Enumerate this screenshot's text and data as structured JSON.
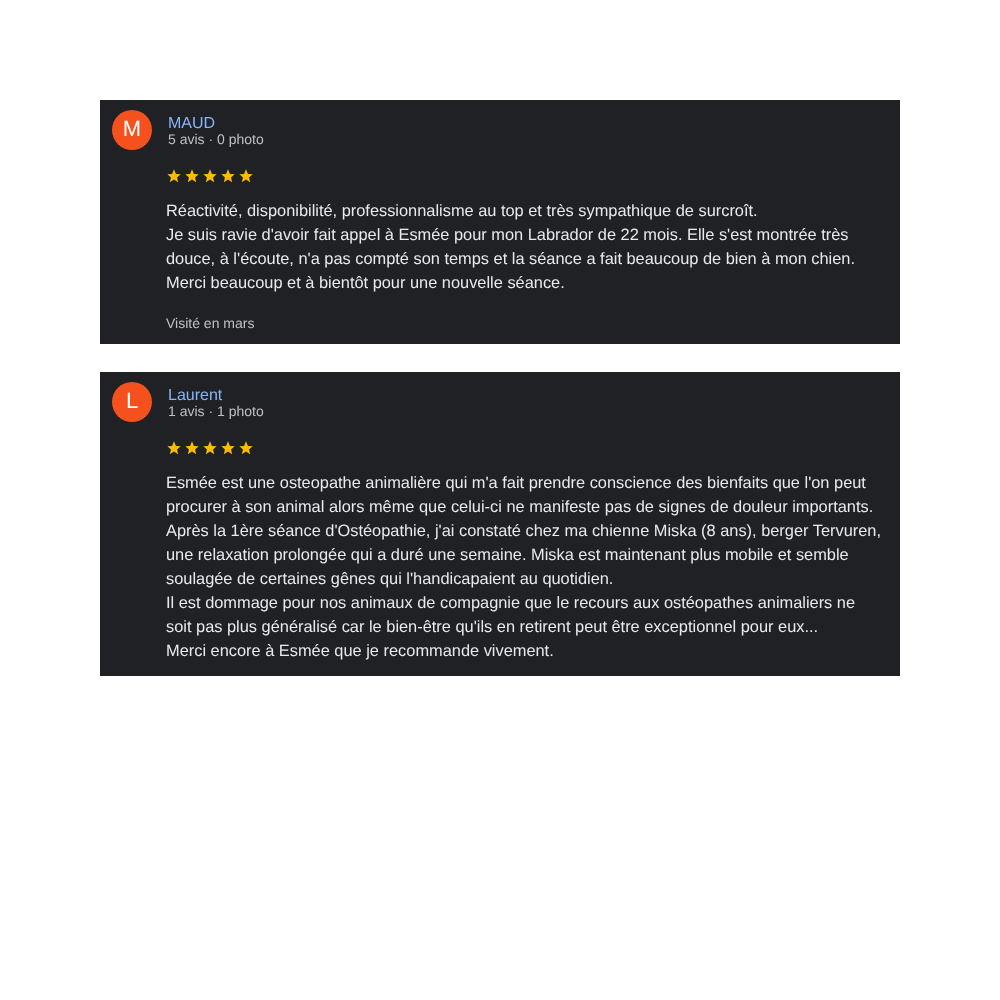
{
  "reviews": [
    {
      "initial": "M",
      "name": "MAUD",
      "meta": "5 avis · 0 photo",
      "stars": 5,
      "paragraphs": [
        "Réactivité, disponibilité, professionnalisme au top et très sympathique de surcroît.",
        "Je suis ravie d'avoir fait appel à Esmée pour mon Labrador de 22 mois. Elle s'est montrée très douce, à l'écoute, n'a pas compté son temps et la séance a fait beaucoup de bien à mon chien.",
        "Merci beaucoup et à bientôt pour une nouvelle séance."
      ],
      "visit": "Visité en mars"
    },
    {
      "initial": "L",
      "name": "Laurent",
      "meta": "1 avis · 1 photo",
      "stars": 5,
      "paragraphs": [
        "Esmée est une osteopathe animalière qui m'a fait prendre conscience des bienfaits que l'on peut procurer à son animal alors même que celui-ci ne manifeste pas de signes de douleur importants. Après la 1ère séance d'Ostéopathie, j'ai constaté chez ma chienne Miska (8 ans), berger Tervuren, une relaxation prolongée qui a duré une semaine. Miska est maintenant plus mobile et semble soulagée de certaines gênes qui l'handicapaient au quotidien.",
        "Il est dommage pour nos animaux de compagnie que le recours aux ostéopathes animaliers ne soit pas plus généralisé car le bien-être qu'ils en retirent peut être exceptionnel pour eux...",
        "Merci encore à Esmée que je recommande vivement."
      ]
    }
  ]
}
